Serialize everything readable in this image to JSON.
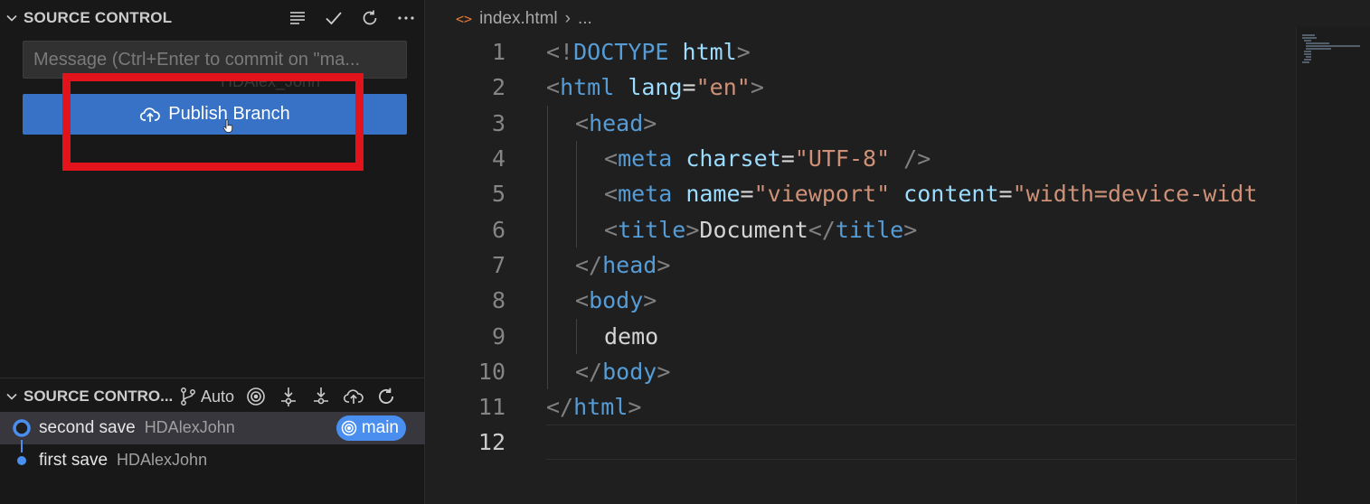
{
  "sidebar": {
    "title": "SOURCE CONTROL",
    "actions": [
      "view-as-tree-icon",
      "commit-check-icon",
      "refresh-icon",
      "more-actions-icon"
    ],
    "message_placeholder": "Message (Ctrl+Enter to commit on \"ma...",
    "ghost_author": "HDAlex_John",
    "publish_label": "Publish Branch",
    "graph": {
      "title": "SOURCE CONTRO...",
      "auto_label": "Auto",
      "commits": [
        {
          "message": "second save",
          "author": "HDAlexJohn",
          "branch": "main"
        },
        {
          "message": "first save",
          "author": "HDAlexJohn"
        }
      ]
    }
  },
  "editor": {
    "breadcrumb": {
      "file": "index.html",
      "ellipsis": "..."
    },
    "active_line": "12",
    "line_numbers": [
      "1",
      "2",
      "3",
      "4",
      "5",
      "6",
      "7",
      "8",
      "9",
      "10",
      "11",
      "12"
    ],
    "code": {
      "l1": {
        "a": "<!",
        "b": "DOCTYPE",
        "c": " html",
        "d": ">"
      },
      "l2": {
        "a": "<",
        "b": "html",
        "c": " lang",
        "d": "=",
        "e": "\"en\"",
        "f": ">"
      },
      "l3": {
        "a": "<",
        "b": "head",
        "c": ">"
      },
      "l4": {
        "a": "<",
        "b": "meta",
        "c": " charset",
        "d": "=",
        "e": "\"UTF-8\"",
        "f": " />"
      },
      "l5": {
        "a": "<",
        "b": "meta",
        "c": " name",
        "d": "=",
        "e": "\"viewport\"",
        "f": " content",
        "g": "=",
        "h": "\"width=device-widt"
      },
      "l6": {
        "a": "<",
        "b": "title",
        "c": ">",
        "d": "Document",
        "e": "</",
        "f": "title",
        "g": ">"
      },
      "l7": {
        "a": "</",
        "b": "head",
        "c": ">"
      },
      "l8": {
        "a": "<",
        "b": "body",
        "c": ">"
      },
      "l9": {
        "a": "demo"
      },
      "l10": {
        "a": "</",
        "b": "body",
        "c": ">"
      },
      "l11": {
        "a": "</",
        "b": "html",
        "c": ">"
      }
    }
  },
  "colors": {
    "accent_button": "#3772c7",
    "highlight_box": "#e3131b",
    "branch_badge": "#4a8ff0"
  }
}
